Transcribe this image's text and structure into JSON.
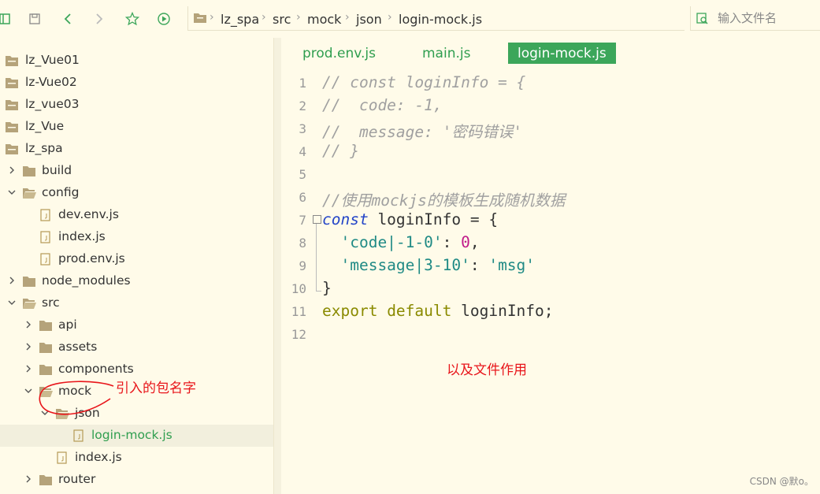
{
  "colors": {
    "background": "#fffbe9",
    "accent_green": "#3ca65a",
    "text_green": "#2f9e4f",
    "annotation_red": "#e8151a"
  },
  "toolbar": {
    "icons": [
      "sidebar-toggle-icon",
      "save-icon",
      "back-arrow-icon",
      "forward-arrow-icon",
      "star-icon",
      "run-icon"
    ]
  },
  "breadcrumb": {
    "items": [
      "lz_spa",
      "src",
      "mock",
      "json",
      "login-mock.js"
    ]
  },
  "search": {
    "placeholder": "输入文件名"
  },
  "tree": {
    "items": [
      {
        "label": "lz_Vue01"
      },
      {
        "label": "lz-Vue02"
      },
      {
        "label": "lz_vue03"
      },
      {
        "label": "lz_Vue"
      },
      {
        "label": "lz_spa"
      },
      {
        "label": "build"
      },
      {
        "label": "config"
      },
      {
        "label": "dev.env.js"
      },
      {
        "label": "index.js"
      },
      {
        "label": "prod.env.js"
      },
      {
        "label": "node_modules"
      },
      {
        "label": "src"
      },
      {
        "label": "api"
      },
      {
        "label": "assets"
      },
      {
        "label": "components"
      },
      {
        "label": "mock"
      },
      {
        "label": "json"
      },
      {
        "label": "login-mock.js"
      },
      {
        "label": "index.js"
      },
      {
        "label": "router"
      }
    ]
  },
  "tabs": [
    "prod.env.js",
    "main.js",
    "login-mock.js"
  ],
  "active_tab": "login-mock.js",
  "editor": {
    "line_numbers": [
      "1",
      "2",
      "3",
      "4",
      "5",
      "6",
      "7",
      "8",
      "9",
      "10",
      "11",
      "12"
    ],
    "comments": {
      "l1": "// const loginInfo = {",
      "l2": "//  code: -1,",
      "l3": "//  message: '密码错误'",
      "l4": "// }",
      "l6": "//使用mockjs的模板生成随机数据"
    },
    "tokens": {
      "const": "const",
      "ident": " loginInfo = {",
      "key1": "  'code|-1-0'",
      "colon": ": ",
      "val1": "0",
      "comma": ",",
      "key2": "  'message|3-10'",
      "val2": "'msg'",
      "close": "}",
      "export": "export",
      "default": " default",
      "export_ident": " loginInfo;"
    }
  },
  "annotations": {
    "package_note": "引入的包名字",
    "file_note": "以及文件作用"
  },
  "watermark": "CSDN @默o。"
}
